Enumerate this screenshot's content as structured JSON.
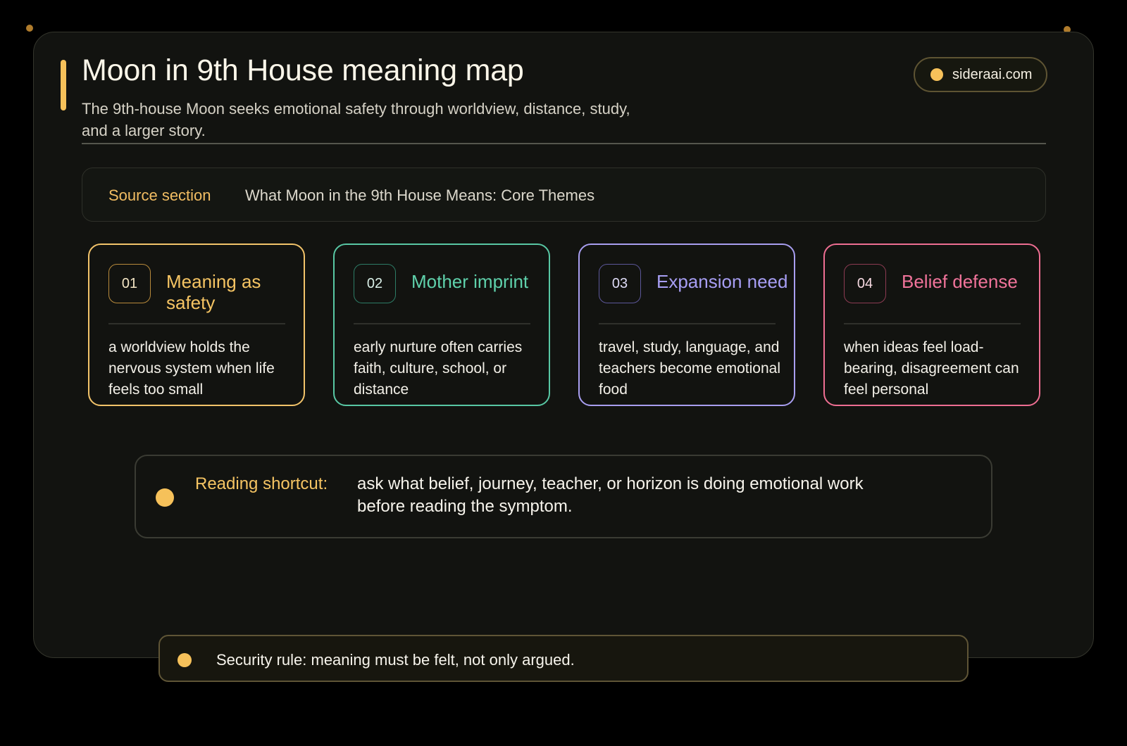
{
  "header": {
    "title": "Moon in 9th House meaning map",
    "subtitle": "The 9th-house Moon seeks emotional safety through worldview, distance, study, and a larger story."
  },
  "badge": {
    "label": "sideraai.com"
  },
  "source": {
    "label": "Source section",
    "value": "What Moon in the 9th House Means: Core Themes"
  },
  "cards": [
    {
      "number": "01",
      "title": "Meaning as safety",
      "description": "a worldview holds the nervous system when life feels too small",
      "color": "#f2c36a"
    },
    {
      "number": "02",
      "title": "Mother imprint",
      "description": "early nurture often carries faith, culture, school, or distance",
      "color": "#58c7a4"
    },
    {
      "number": "03",
      "title": "Expansion need",
      "description": "travel, study, language, and teachers become emotional food",
      "color": "#a89ef0"
    },
    {
      "number": "04",
      "title": "Belief defense",
      "description": "when ideas feel load-bearing, disagreement can feel personal",
      "color": "#ee6e92"
    }
  ],
  "shortcut": {
    "label": "Reading shortcut:",
    "text": "ask what belief, journey, teacher, or horizon is doing emotional work before reading the symptom."
  },
  "footer": {
    "text": "Security rule: meaning must be felt, not only argued."
  },
  "colors": {
    "accent": "#f6c15a",
    "background": "#121310"
  }
}
